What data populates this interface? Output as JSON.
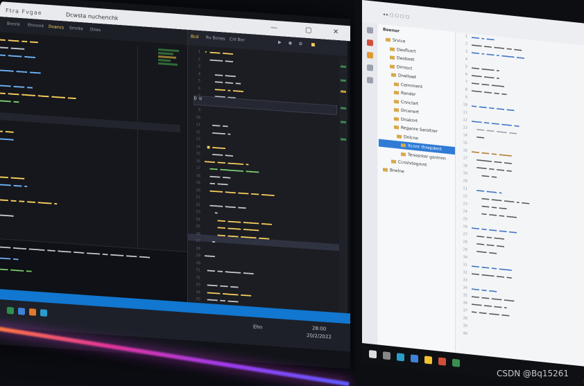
{
  "watermark": "CSDN @Bq15261",
  "left_window": {
    "title": "Dcwsta nuchenchk",
    "menu": "Ftra  Fvgae",
    "controls": [
      "—",
      "▢",
      "✕"
    ]
  },
  "left_tabs": [
    "Bnnnk",
    "Ehnnmt",
    "Dvancs",
    "Srnnte",
    "Dnes"
  ],
  "mid_tabs": [
    "Bcd",
    "Rv Bcnes",
    "Cnl Bnr"
  ],
  "mid_search": "D  U",
  "right_tree": {
    "root": "Beenor",
    "items": [
      "Srvice",
      "Deoflcert",
      "Deoboet",
      "Drrnoct",
      "Drwllowt",
      "Cemnnent",
      "Rander",
      "Cnnclart",
      "Drcenert",
      "Dnaknrt",
      "Reganre Saroltrer",
      "Dnlcne",
      "Itcnnr threpdent",
      "Tenosnter gsnlnnn",
      "Ccnslvtegmnt",
      "Bnelne"
    ],
    "selected": "Itcnnr threpdent"
  },
  "taskbar_left": {
    "time": "28:00",
    "date": "20/2/2022",
    "label": "Ehn"
  },
  "colors": {
    "accent": "#1177d0",
    "folder": "#d9a84a",
    "keyword": "#ffd35c",
    "string": "#7fd46e",
    "type": "#6fb7ff"
  }
}
